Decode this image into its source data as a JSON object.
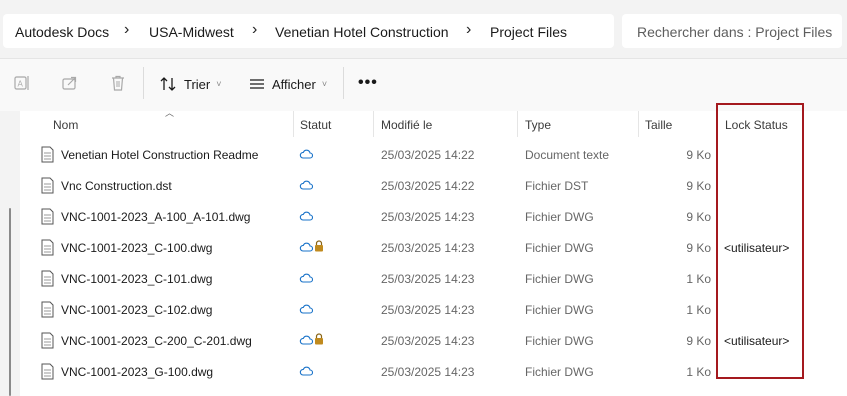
{
  "breadcrumb": [
    "Autodesk Docs",
    "USA-Midwest",
    "Venetian Hotel Construction",
    "Project Files"
  ],
  "search": {
    "placeholder": "Rechercher dans : Project Files"
  },
  "toolbar": {
    "sort_label": "Trier",
    "view_label": "Afficher",
    "icons": [
      "rename-icon",
      "share-icon",
      "delete-icon",
      "sort-icon",
      "view-list-icon",
      "more-options-icon"
    ]
  },
  "columns": {
    "name": "Nom",
    "status": "Statut",
    "modified": "Modifié le",
    "type": "Type",
    "size": "Taille",
    "lock": "Lock Status"
  },
  "files": [
    {
      "name": "Venetian Hotel Construction Readme",
      "modified": "25/03/2025 14:22",
      "type": "Document texte",
      "size": "9 Ko",
      "lock": "",
      "locked": false
    },
    {
      "name": "Vnc Construction.dst",
      "modified": "25/03/2025 14:22",
      "type": "Fichier DST",
      "size": "9 Ko",
      "lock": "",
      "locked": false
    },
    {
      "name": "VNC-1001-2023_A-100_A-101.dwg",
      "modified": "25/03/2025 14:23",
      "type": "Fichier DWG",
      "size": "9 Ko",
      "lock": "",
      "locked": false
    },
    {
      "name": "VNC-1001-2023_C-100.dwg",
      "modified": "25/03/2025 14:23",
      "type": "Fichier DWG",
      "size": "9 Ko",
      "lock": "<utilisateur>",
      "locked": true
    },
    {
      "name": "VNC-1001-2023_C-101.dwg",
      "modified": "25/03/2025 14:23",
      "type": "Fichier DWG",
      "size": "1 Ko",
      "lock": "",
      "locked": false
    },
    {
      "name": "VNC-1001-2023_C-102.dwg",
      "modified": "25/03/2025 14:23",
      "type": "Fichier DWG",
      "size": "1 Ko",
      "lock": "",
      "locked": false
    },
    {
      "name": "VNC-1001-2023_C-200_C-201.dwg",
      "modified": "25/03/2025 14:23",
      "type": "Fichier DWG",
      "size": "9 Ko",
      "lock": "<utilisateur>",
      "locked": true
    },
    {
      "name": "VNC-1001-2023_G-100.dwg",
      "modified": "25/03/2025 14:23",
      "type": "Fichier DWG",
      "size": "1 Ko",
      "lock": "",
      "locked": false
    }
  ],
  "colors": {
    "highlight": "#a4191e",
    "cloud": "#1a73c9",
    "padlock": "#c08a1e"
  }
}
